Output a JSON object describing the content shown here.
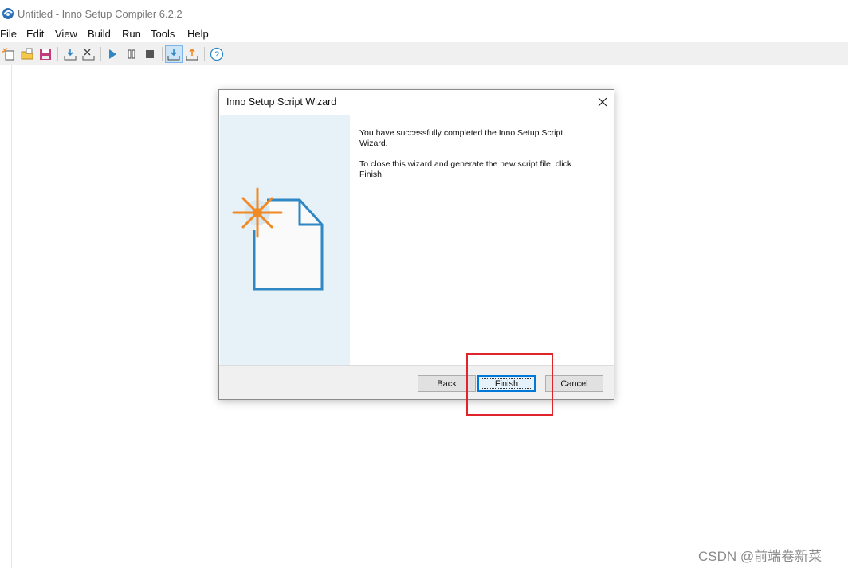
{
  "window": {
    "title": "Untitled - Inno Setup Compiler 6.2.2"
  },
  "menu": [
    "File",
    "Edit",
    "View",
    "Build",
    "Run",
    "Tools",
    "Help"
  ],
  "toolbar": {
    "buttons": [
      "new-icon",
      "open-icon",
      "save-icon",
      "compile-icon",
      "stop-compile-icon",
      "run-icon",
      "pause-icon",
      "terminate-icon",
      "target-setup-icon",
      "target-uninstall-icon",
      "help-icon"
    ]
  },
  "dialog": {
    "title": "Inno Setup Script Wizard",
    "paragraph1": "You have successfully completed the Inno Setup Script Wizard.",
    "paragraph2": "To close this wizard and generate the new script file, click Finish.",
    "buttons": {
      "back": "Back",
      "finish": "Finish",
      "cancel": "Cancel"
    }
  },
  "watermark": "CSDN @前端卷新菜",
  "colors": {
    "highlight": "#e0242c",
    "wizard_side": "#e6f1f8",
    "accent_blue": "#2f87c4",
    "star_orange": "#f08a24"
  }
}
